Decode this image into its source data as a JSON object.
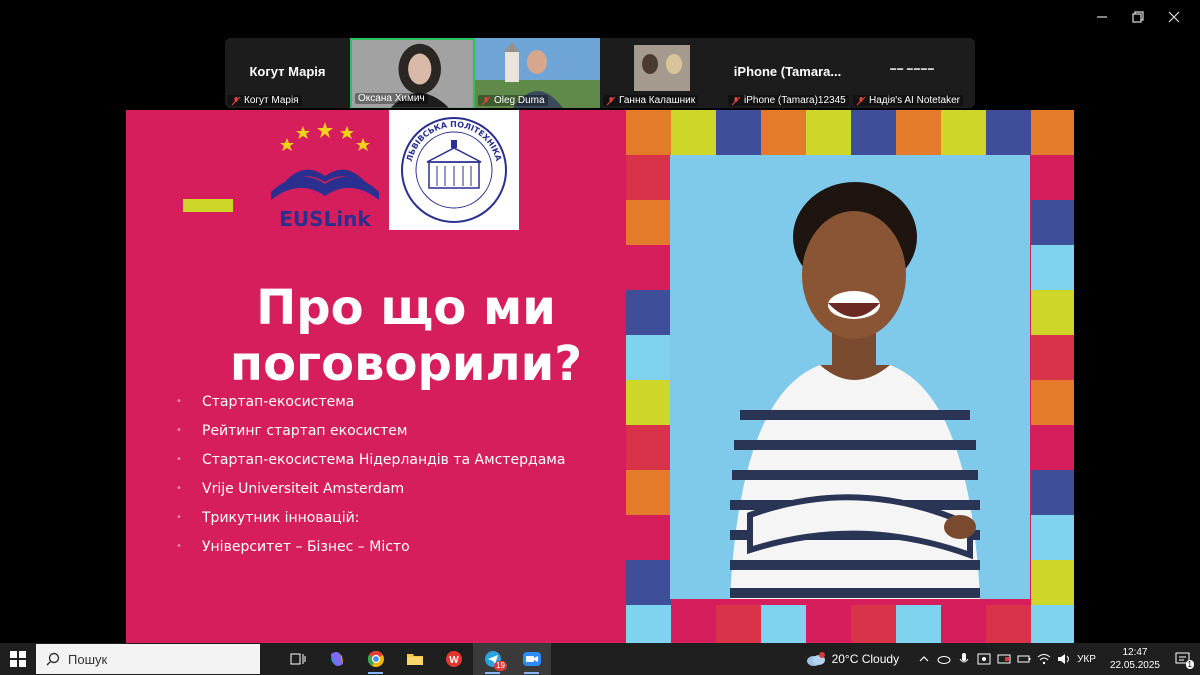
{
  "participants": [
    {
      "big_name": "Когут Марія",
      "label": "Когут Марія",
      "video": false
    },
    {
      "big_name": "",
      "label": "Оксана Химич",
      "video": true,
      "active": true
    },
    {
      "big_name": "",
      "label": "Oleg Duma",
      "video": true
    },
    {
      "big_name": "",
      "label": "Ганна Калашник",
      "video": true
    },
    {
      "big_name": "iPhone  (Tamara...",
      "label": "iPhone (Tamara)12345",
      "video": false
    },
    {
      "big_name": "",
      "label": "Надія's AI Notetaker",
      "video": false
    }
  ],
  "slide": {
    "logo_text": "EUSLink",
    "lviv_logo_text": "ЛЬВІВСЬКА ПОЛІТЕХНІКА",
    "title_line1": "Про що ми",
    "title_line2": "поговорили?",
    "bullets": [
      "Стартап-екосистема",
      "Рейтинг стартап екосистем",
      "Стартап-екосистема Нідерландів та Амстердама",
      "Vrije Universiteit Amsterdam",
      "Трикутник інновацій:",
      "Університет – Бізнес – Місто"
    ],
    "colors": {
      "background": "#d51e5b",
      "accent": "#cdd629",
      "logo_blue": "#2b2f8f"
    }
  },
  "taskbar": {
    "search_placeholder": "Пошук",
    "telegram_badge": "19",
    "weather": "20°C  Cloudy",
    "language": "УКР",
    "time": "12:47",
    "date": "22.05.2025",
    "notification_count": "1"
  }
}
